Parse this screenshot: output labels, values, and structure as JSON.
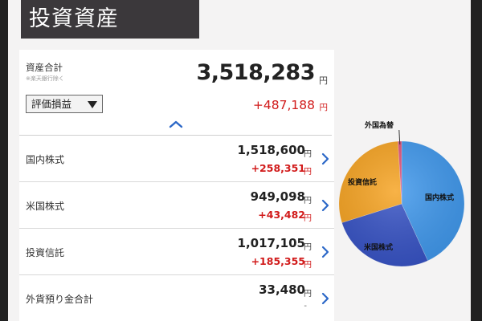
{
  "header": {
    "title": "投資資産"
  },
  "summary": {
    "total_label": "資産合計",
    "total_note": "※楽天銀行除く",
    "total_value": "3,518,283",
    "total_unit": "円",
    "eval_button_label": "評価損益",
    "gain_value": "+487,188",
    "gain_unit": "円"
  },
  "rows": [
    {
      "label": "国内株式",
      "value": "1,518,600",
      "unit": "円",
      "gain": "+258,351",
      "gain_unit": "円"
    },
    {
      "label": "米国株式",
      "value": "949,098",
      "unit": "円",
      "gain": "+43,482",
      "gain_unit": "円"
    },
    {
      "label": "投資信託",
      "value": "1,017,105",
      "unit": "円",
      "gain": "+185,355",
      "gain_unit": "円"
    },
    {
      "label": "外貨預り金合計",
      "value": "33,480",
      "unit": "円",
      "gain": "-",
      "gain_unit": ""
    }
  ],
  "colors": {
    "domestic": "#3e97ec",
    "us": "#3551c4",
    "fund": "#f6a21f",
    "fx": "#e0507a",
    "gain": "#d11a1a",
    "header_bg": "#3b383b"
  },
  "chart_data": {
    "type": "pie",
    "slices": [
      {
        "name": "国内株式",
        "value": 1518600
      },
      {
        "name": "米国株式",
        "value": 949098
      },
      {
        "name": "投資信託",
        "value": 1017105
      },
      {
        "name": "外国為替",
        "value": 33480
      }
    ]
  }
}
